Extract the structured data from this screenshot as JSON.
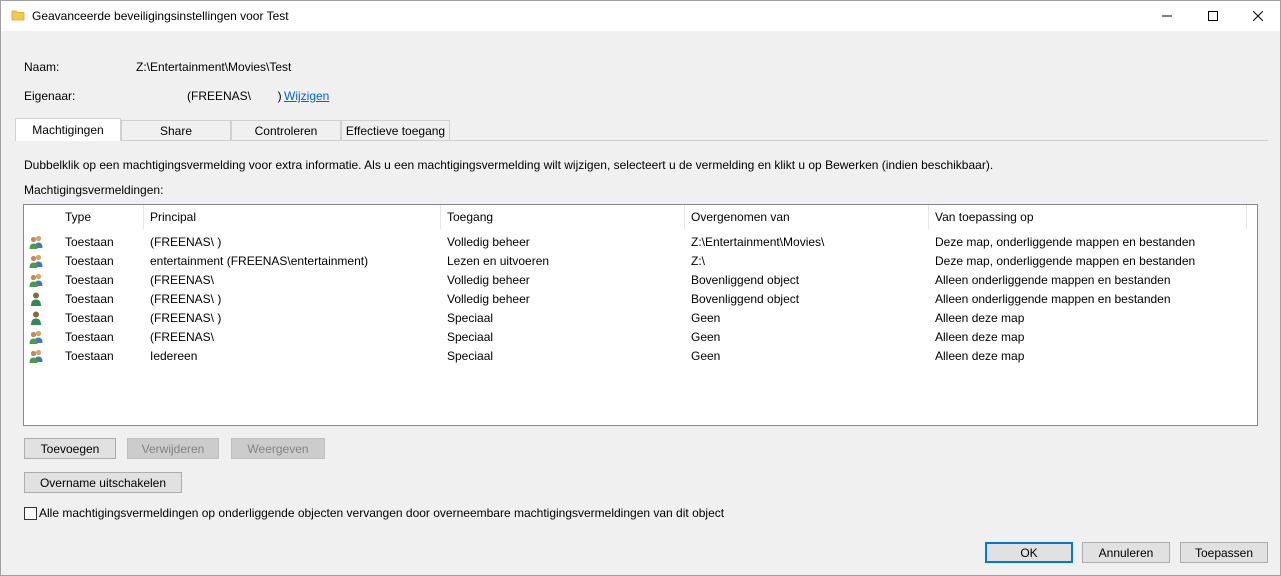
{
  "window": {
    "title": "Geavanceerde beveiligingsinstellingen voor Test",
    "folder_icon": "folder-icon",
    "controls": {
      "minimize": "minimize-icon",
      "maximize": "maximize-icon",
      "close": "close-icon"
    }
  },
  "info": {
    "name_label": "Naam:",
    "name_value": "Z:\\Entertainment\\Movies\\Test",
    "owner_label": "Eigenaar:",
    "owner_value": "(FREENAS\\        )",
    "owner_change": "Wijzigen"
  },
  "tabs": [
    {
      "label": "Machtigingen",
      "active": true
    },
    {
      "label": "Share",
      "active": false
    },
    {
      "label": "Controleren",
      "active": false
    },
    {
      "label": "Effectieve toegang",
      "active": false
    }
  ],
  "panel": {
    "description": "Dubbelklik op een machtigingsvermelding voor extra informatie. Als u een machtigingsvermelding wilt wijzigen, selecteert u de vermelding en klikt u op Bewerken (indien beschikbaar).",
    "list_label": "Machtigingsvermeldingen:"
  },
  "table": {
    "columns": [
      "Type",
      "Principal",
      "Toegang",
      "Overgenomen van",
      "Van toepassing op"
    ],
    "rows": [
      {
        "icon": "group-icon",
        "type": "Toestaan",
        "principal": "                (FREENAS\\        )",
        "access": "Volledig beheer",
        "inherited": "Z:\\Entertainment\\Movies\\",
        "applies": "Deze map, onderliggende mappen en bestanden"
      },
      {
        "icon": "group-icon",
        "type": "Toestaan",
        "principal": "entertainment (FREENAS\\entertainment)",
        "access": "Lezen en uitvoeren",
        "inherited": "Z:\\",
        "applies": "Deze map, onderliggende mappen en bestanden"
      },
      {
        "icon": "group-icon",
        "type": "Toestaan",
        "principal": "               (FREENAS\\",
        "access": "Volledig beheer",
        "inherited": "Bovenliggend object",
        "applies": "Alleen onderliggende mappen en bestanden"
      },
      {
        "icon": "user-icon",
        "type": "Toestaan",
        "principal": "                    (FREENAS\\        )",
        "access": "Volledig beheer",
        "inherited": "Bovenliggend object",
        "applies": "Alleen onderliggende mappen en bestanden"
      },
      {
        "icon": "user-icon",
        "type": "Toestaan",
        "principal": "                    (FREENAS\\        )",
        "access": "Speciaal",
        "inherited": "Geen",
        "applies": "Alleen deze map"
      },
      {
        "icon": "group-icon",
        "type": "Toestaan",
        "principal": "                (FREENAS\\",
        "access": "Speciaal",
        "inherited": "Geen",
        "applies": "Alleen deze map"
      },
      {
        "icon": "group-icon",
        "type": "Toestaan",
        "principal": "Iedereen",
        "access": "Speciaal",
        "inherited": "Geen",
        "applies": "Alleen deze map"
      }
    ]
  },
  "buttons": {
    "add": "Toevoegen",
    "remove": "Verwijderen",
    "view": "Weergeven",
    "disable_inheritance": "Overname uitschakelen"
  },
  "replace_checkbox": {
    "label": "Alle machtigingsvermeldingen op onderliggende objecten vervangen door overneembare machtigingsvermeldingen van dit object",
    "checked": false
  },
  "footer": {
    "ok": "OK",
    "cancel": "Annuleren",
    "apply": "Toepassen"
  }
}
